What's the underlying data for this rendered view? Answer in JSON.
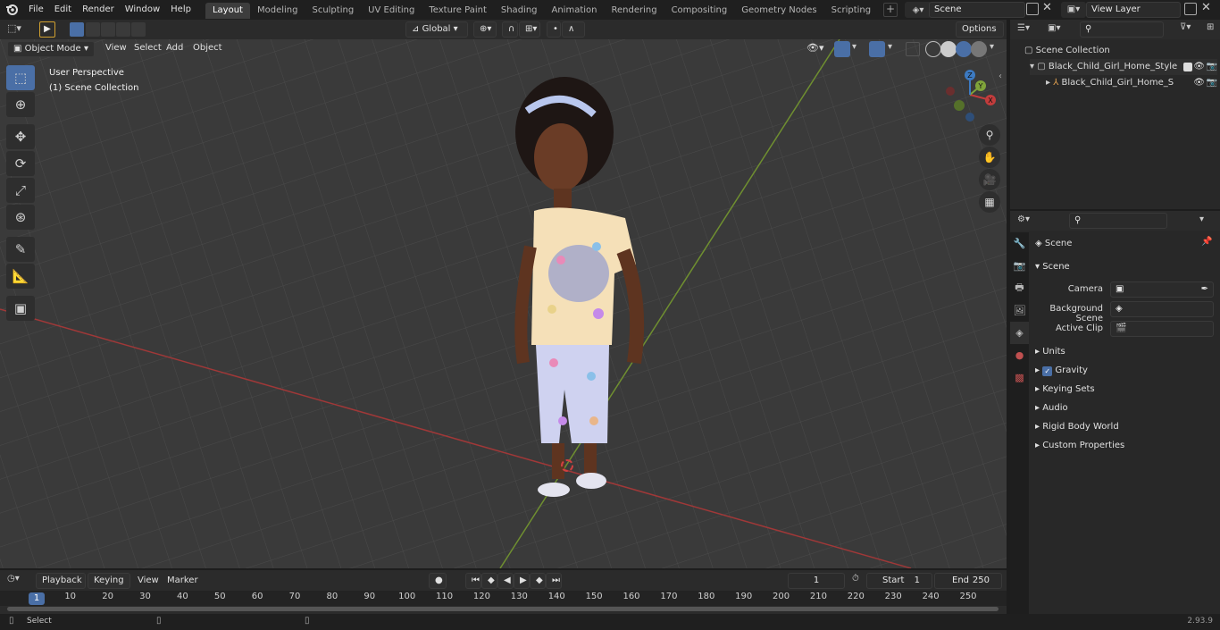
{
  "topbar": {
    "menus": [
      "File",
      "Edit",
      "Render",
      "Window",
      "Help"
    ],
    "workspaces": [
      "Layout",
      "Modeling",
      "Sculpting",
      "UV Editing",
      "Texture Paint",
      "Shading",
      "Animation",
      "Rendering",
      "Compositing",
      "Geometry Nodes",
      "Scripting"
    ],
    "active_workspace": "Layout",
    "scene_name": "Scene",
    "view_layer": "View Layer"
  },
  "viewport_header": {
    "mode": "Object Mode",
    "menus": [
      "View",
      "Select",
      "Add",
      "Object"
    ],
    "orientation": "Global",
    "options": "Options"
  },
  "viewport": {
    "perspective_label": "User Perspective",
    "collection_label": "(1) Scene Collection"
  },
  "gizmo": {
    "x": "X",
    "y": "Y",
    "z": "Z"
  },
  "outliner": {
    "root": "Scene Collection",
    "items": [
      "Black_Child_Girl_Home_Style",
      "Black_Child_Girl_Home_S"
    ]
  },
  "properties": {
    "context_title": "Scene",
    "section": "Scene",
    "camera_label": "Camera",
    "background_scene_label": "Background Scene",
    "active_clip_label": "Active Clip",
    "subpanels": [
      "Units",
      "Gravity",
      "Keying Sets",
      "Audio",
      "Rigid Body World",
      "Custom Properties"
    ],
    "gravity_checked": true
  },
  "timeline": {
    "menus": [
      "Playback",
      "Keying",
      "View",
      "Marker"
    ],
    "current_frame": "1",
    "start_label": "Start",
    "start_value": "1",
    "end_label": "End",
    "end_value": "250",
    "ticks": [
      "1",
      "10",
      "20",
      "30",
      "40",
      "50",
      "60",
      "70",
      "80",
      "90",
      "100",
      "110",
      "120",
      "130",
      "140",
      "150",
      "160",
      "170",
      "180",
      "190",
      "200",
      "210",
      "220",
      "230",
      "240",
      "250"
    ]
  },
  "statusbar": {
    "left": "Select",
    "version": "2.93.9"
  },
  "colors": {
    "accent": "#4a6fa6",
    "x_axis": "#c23c3c",
    "y_axis": "#7fa33a",
    "z_axis": "#3c7ac2"
  }
}
